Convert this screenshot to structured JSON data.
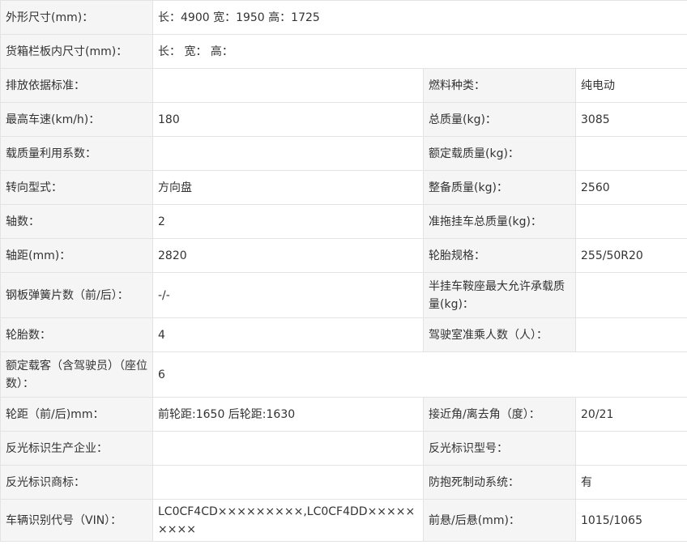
{
  "rows": [
    {
      "label": "外形尺寸(mm)：",
      "value": "长：4900 宽：1950 高：1725"
    },
    {
      "label": "货箱栏板内尺寸(mm)：",
      "value": "长： 宽： 高："
    },
    {
      "label": "排放依据标准：",
      "value": "",
      "label2": "燃料种类：",
      "value2": "纯电动"
    },
    {
      "label": "最高车速(km/h)：",
      "value": "180",
      "label2": "总质量(kg)：",
      "value2": "3085"
    },
    {
      "label": "载质量利用系数：",
      "value": "",
      "label2": "额定载质量(kg)：",
      "value2": ""
    },
    {
      "label": "转向型式：",
      "value": "方向盘",
      "label2": "整备质量(kg)：",
      "value2": "2560"
    },
    {
      "label": "轴数：",
      "value": "2",
      "label2": "准拖挂车总质量(kg)：",
      "value2": ""
    },
    {
      "label": "轴距(mm)：",
      "value": "2820",
      "label2": "轮胎规格：",
      "value2": "255/50R20"
    },
    {
      "label": "钢板弹簧片数（前/后）：",
      "value": "-/-",
      "label2": "半挂车鞍座最大允许承载质量(kg)：",
      "value2": ""
    },
    {
      "label": "轮胎数：",
      "value": "4",
      "label2": "驾驶室准乘人数（人）：",
      "value2": ""
    },
    {
      "label": "额定载客（含驾驶员）（座位数）：",
      "value": "6"
    },
    {
      "label": "轮距（前/后)mm：",
      "value": "前轮距:1650 后轮距:1630",
      "label2": "接近角/离去角（度）：",
      "value2": "20/21"
    },
    {
      "label": "反光标识生产企业：",
      "value": "",
      "label2": "反光标识型号：",
      "value2": ""
    },
    {
      "label": "反光标识商标：",
      "value": "",
      "label2": "防抱死制动系统：",
      "value2": "有"
    },
    {
      "label": "车辆识别代号（VIN）：",
      "value": "LC0CF4CD×××××××××,LC0CF4DD×××××××××",
      "label2": "前悬/后悬(mm)：",
      "value2": "1015/1065"
    }
  ]
}
